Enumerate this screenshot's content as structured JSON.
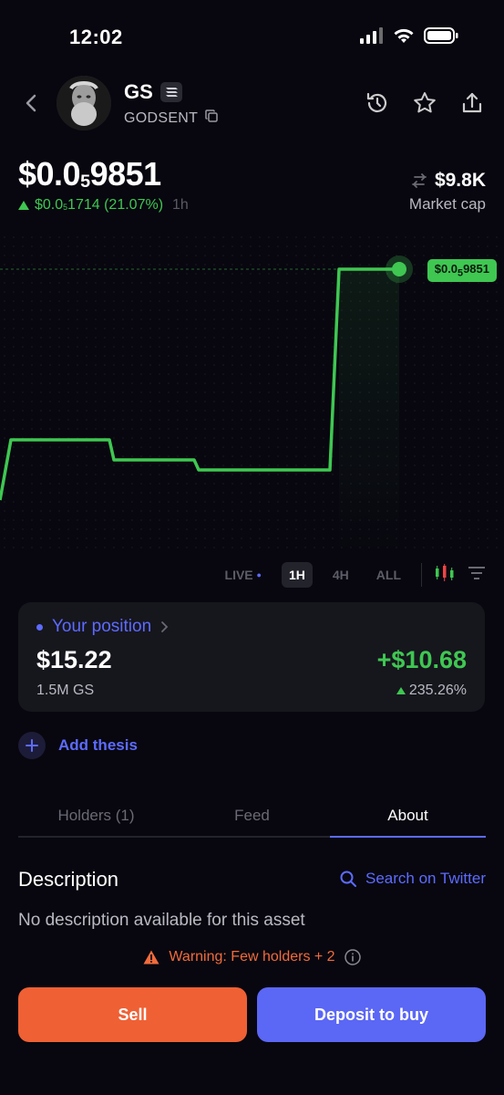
{
  "status": {
    "time": "12:02"
  },
  "header": {
    "ticker": "GS",
    "name": "GODSENT"
  },
  "price": {
    "lead": "$0.0",
    "sub_zeros": "5",
    "digits": "9851",
    "change_lead": "$0.0",
    "change_sub": "5",
    "change_digits": "1714",
    "change_pct": "(21.07%)",
    "period": "1h"
  },
  "market_cap": {
    "value": "$9.8K",
    "label": "Market cap"
  },
  "chart": {
    "tag_lead": "$0.0",
    "tag_sub": "5",
    "tag_digits": "9851",
    "line_color": "#3fc752"
  },
  "chart_data": {
    "type": "line",
    "title": "",
    "series": [
      {
        "values": [
          7.5e-06,
          8.1e-06,
          8.1e-06,
          7.9e-06,
          7.9e-06,
          7.8e-06,
          7.8e-06,
          9.8e-06,
          9.8e-06
        ]
      }
    ],
    "current_value_label": "$0.0₅9851",
    "grid": true
  },
  "ranges": {
    "live": "LIVE",
    "h1": "1H",
    "h4": "4H",
    "all": "ALL",
    "selected": "1H"
  },
  "position": {
    "title": "Your position",
    "value": "$15.22",
    "quantity": "1.5M GS",
    "pnl": "+$10.68",
    "pnl_pct": "235.26%"
  },
  "thesis": {
    "label": "Add thesis"
  },
  "tabs": [
    {
      "label": "Holders (1)"
    },
    {
      "label": "Feed"
    },
    {
      "label": "About"
    }
  ],
  "about": {
    "title": "Description",
    "search_label": "Search on Twitter",
    "text": "No description available for this asset"
  },
  "warning": {
    "text": "Warning: Few holders + 2"
  },
  "actions": {
    "sell": "Sell",
    "buy": "Deposit to buy"
  },
  "colors": {
    "accent": "#5d6bff",
    "up": "#3fc752",
    "sell": "#ef6034",
    "buy": "#5b67f5"
  }
}
